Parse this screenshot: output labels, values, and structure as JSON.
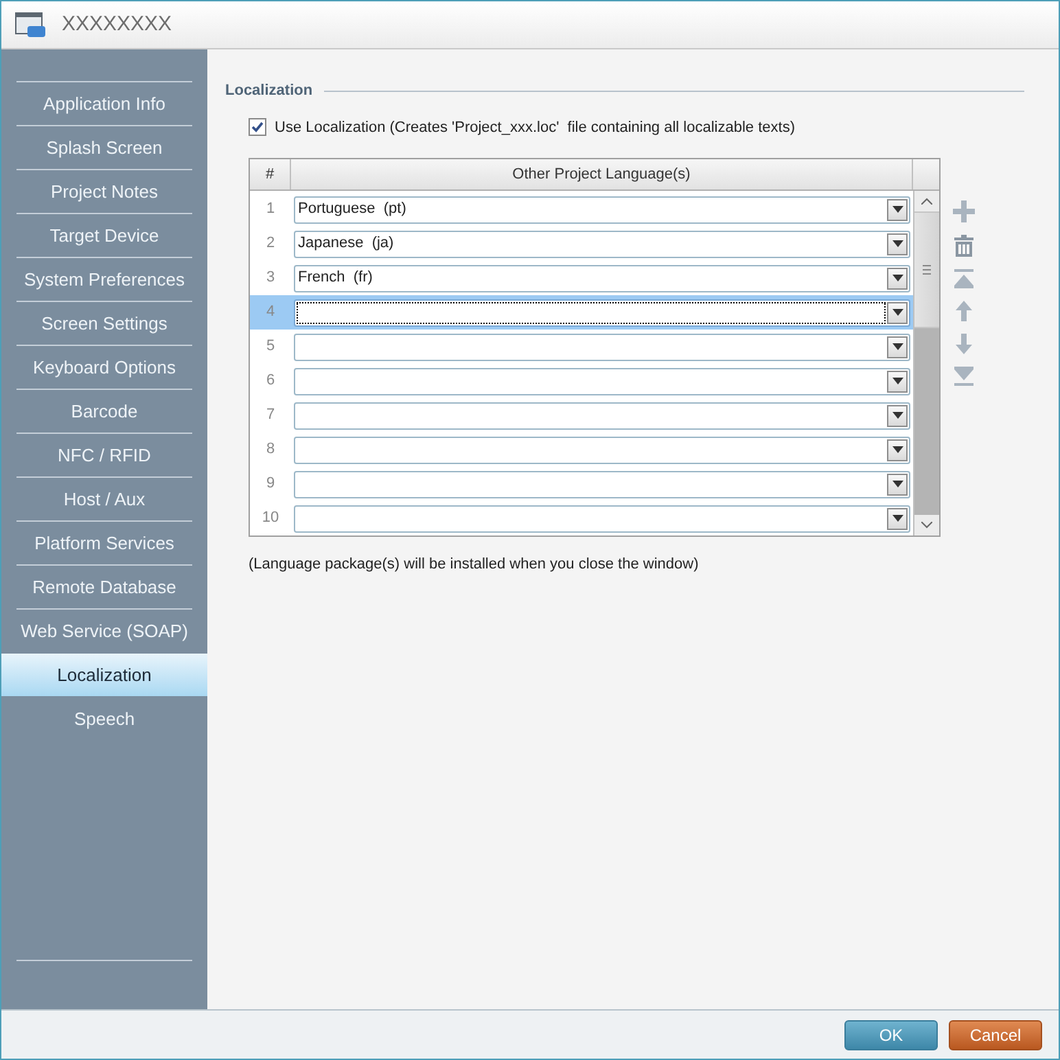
{
  "window": {
    "title": "XXXXXXXX"
  },
  "sidebar": {
    "items": [
      {
        "label": "Application Info",
        "selected": false
      },
      {
        "label": "Splash Screen",
        "selected": false
      },
      {
        "label": "Project Notes",
        "selected": false
      },
      {
        "label": "Target Device",
        "selected": false
      },
      {
        "label": "System Preferences",
        "selected": false
      },
      {
        "label": "Screen Settings",
        "selected": false
      },
      {
        "label": "Keyboard Options",
        "selected": false
      },
      {
        "label": "Barcode",
        "selected": false
      },
      {
        "label": "NFC / RFID",
        "selected": false
      },
      {
        "label": "Host / Aux",
        "selected": false
      },
      {
        "label": "Platform Services",
        "selected": false
      },
      {
        "label": "Remote Database",
        "selected": false
      },
      {
        "label": "Web Service (SOAP)",
        "selected": false
      },
      {
        "label": "Localization",
        "selected": true
      },
      {
        "label": "Speech",
        "selected": false
      }
    ]
  },
  "section": {
    "title": "Localization",
    "use_localization": {
      "label": "Use Localization (Creates 'Project_xxx.loc'  file containing all localizable texts)",
      "checked": true
    },
    "table": {
      "columns": [
        "#",
        "Other Project Language(s)"
      ],
      "rows": [
        {
          "number": "1",
          "value": "Portuguese  (pt)",
          "selected": false
        },
        {
          "number": "2",
          "value": "Japanese  (ja)",
          "selected": false
        },
        {
          "number": "3",
          "value": "French  (fr)",
          "selected": false
        },
        {
          "number": "4",
          "selected": true
        },
        {
          "number": "5",
          "selected": false
        },
        {
          "number": "6",
          "selected": false
        },
        {
          "number": "7",
          "selected": false
        },
        {
          "number": "8",
          "selected": false
        },
        {
          "number": "9",
          "selected": false
        },
        {
          "number": "10",
          "selected": false
        }
      ]
    },
    "note": "(Language package(s) will be installed when you close the window)"
  },
  "buttons": [
    {
      "label": "OK",
      "kind": "primary"
    },
    {
      "label": "Cancel",
      "kind": "cancel"
    }
  ]
}
